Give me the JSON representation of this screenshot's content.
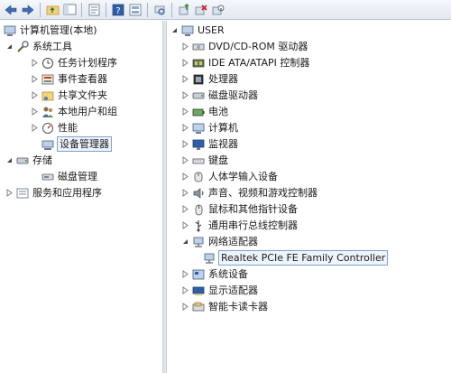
{
  "toolbar": {
    "buttons": [
      "back-icon",
      "forward-icon",
      "up-folder-icon",
      "show-hide-tree-icon",
      "properties-icon",
      "help-icon",
      "view-icon",
      "scan-hardware-icon",
      "update-driver-icon",
      "uninstall-icon",
      "disable-icon"
    ]
  },
  "left_tree": {
    "root": "计算机管理(本地)",
    "system_tools": "系统工具",
    "task_scheduler": "任务计划程序",
    "event_viewer": "事件查看器",
    "shared_folders": "共享文件夹",
    "local_users": "本地用户和组",
    "performance": "性能",
    "device_manager": "设备管理器",
    "storage": "存储",
    "disk_management": "磁盘管理",
    "services_apps": "服务和应用程序"
  },
  "device_tree": {
    "root": "USER",
    "items": [
      "DVD/CD-ROM 驱动器",
      "IDE ATA/ATAPI 控制器",
      "处理器",
      "磁盘驱动器",
      "电池",
      "计算机",
      "监视器",
      "键盘",
      "人体学输入设备",
      "声音、视频和游戏控制器",
      "鼠标和其他指针设备",
      "通用串行总线控制器",
      "网络适配器"
    ],
    "network_child": "Realtek PCIe FE Family Controller",
    "after": [
      "系统设备",
      "显示适配器",
      "智能卡读卡器"
    ]
  },
  "colors": {
    "accent": "#7da2ce",
    "selection_bg": "#eef4fb"
  }
}
